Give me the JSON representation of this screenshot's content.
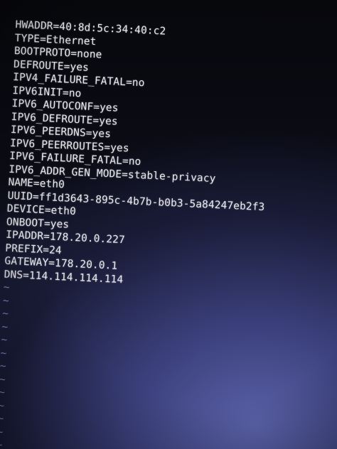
{
  "config_lines": [
    "HWADDR=40:8d:5c:34:40:c2",
    "TYPE=Ethernet",
    "BOOTPROTO=none",
    "DEFROUTE=yes",
    "IPV4_FAILURE_FATAL=no",
    "IPV6INIT=no",
    "IPV6_AUTOCONF=yes",
    "IPV6_DEFROUTE=yes",
    "IPV6_PEERDNS=yes",
    "IPV6_PEERROUTES=yes",
    "IPV6_FAILURE_FATAL=no",
    "IPV6_ADDR_GEN_MODE=stable-privacy",
    "NAME=eth0",
    "UUID=ff1d3643-895c-4b7b-b0b3-5a84247eb2f3",
    "DEVICE=eth0",
    "ONBOOT=yes",
    "IPADDR=178.20.0.227",
    "PREFIX=24",
    "GATEWAY=178.20.0.1",
    "DNS=114.114.114.114"
  ],
  "empty_line_marker": "~",
  "empty_line_count": 13,
  "colors": {
    "text": "#e8e8ee",
    "tilde": "#7f86c8",
    "background": "#0a0b12"
  }
}
